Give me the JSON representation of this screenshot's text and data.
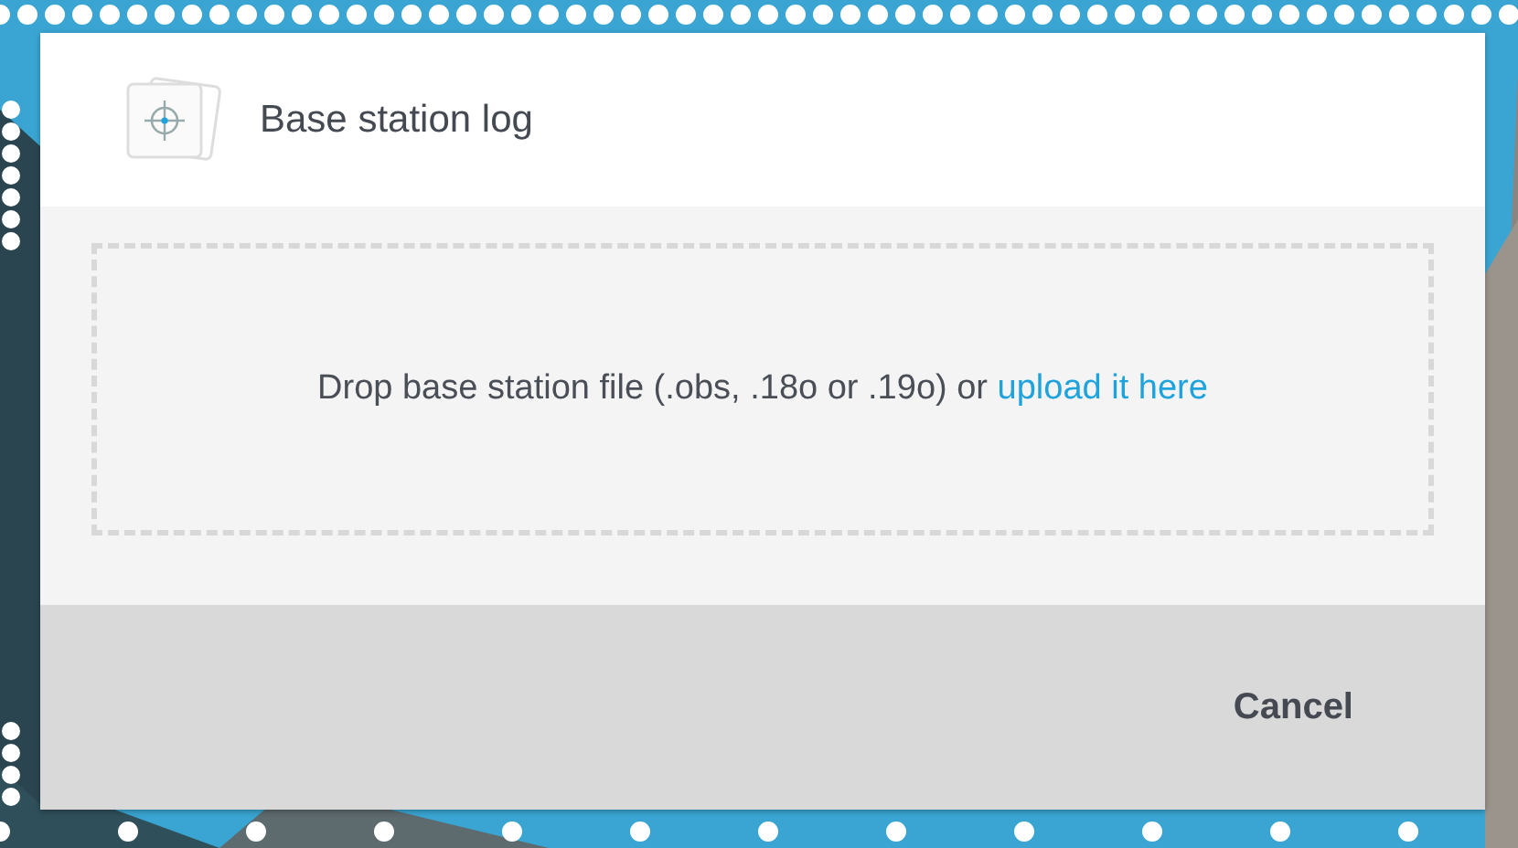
{
  "dialog": {
    "title": "Base station log",
    "dropzone": {
      "text": "Drop base station file (.obs, .18o or .19o) or ",
      "link": "upload it here"
    },
    "buttons": [
      "Cancel"
    ]
  }
}
